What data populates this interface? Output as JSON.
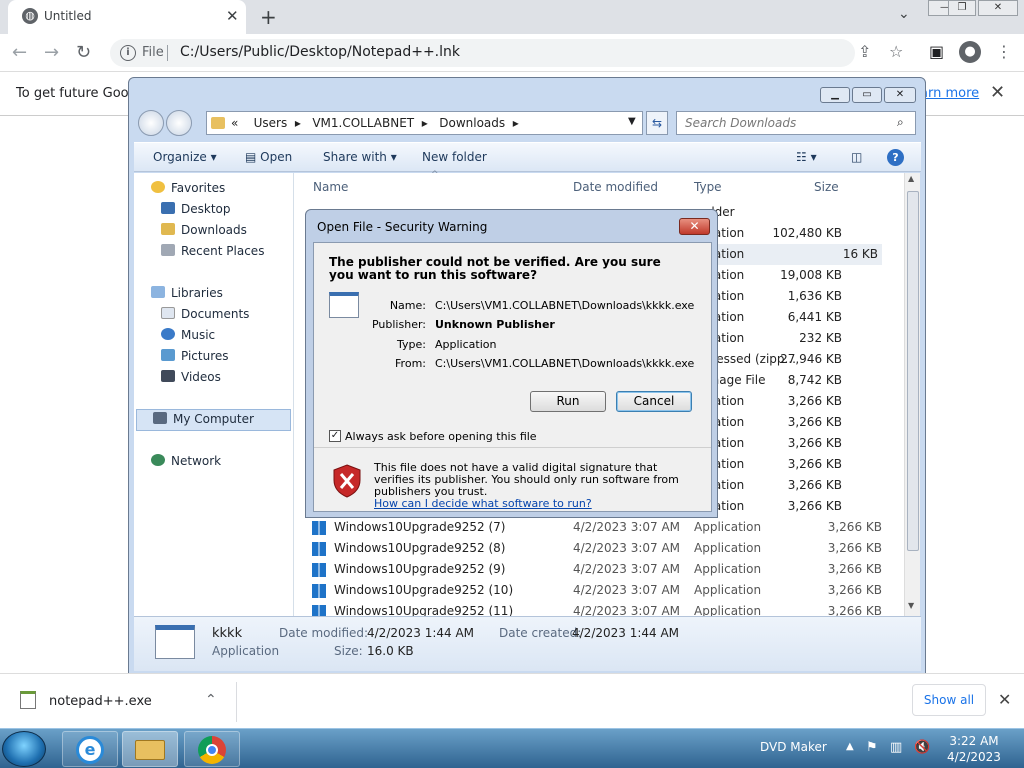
{
  "browser": {
    "tab_title": "Untitled",
    "url_scheme": "File",
    "url": "C:/Users/Public/Desktop/Notepad++.lnk",
    "infobar_text": "To get future Googl",
    "infobar_link": "arn more"
  },
  "explorer": {
    "breadcrumb": [
      "«",
      "Users",
      "VM1.COLLABNET",
      "Downloads"
    ],
    "search_placeholder": "Search Downloads",
    "commands": {
      "organize": "Organize",
      "open": "Open",
      "share": "Share with",
      "new_folder": "New folder"
    },
    "nav": {
      "favorites": "Favorites",
      "desktop": "Desktop",
      "downloads": "Downloads",
      "recent": "Recent Places",
      "libraries": "Libraries",
      "documents": "Documents",
      "music": "Music",
      "pictures": "Pictures",
      "videos": "Videos",
      "computer": "My Computer",
      "network": "Network"
    },
    "columns": {
      "name": "Name",
      "date": "Date modified",
      "type": "Type",
      "size": "Size"
    },
    "right_rows": [
      {
        "type": "older",
        "size": ""
      },
      {
        "type": "ication",
        "size": "102,480 KB"
      },
      {
        "type": "ication",
        "size": "16 KB"
      },
      {
        "type": "ication",
        "size": "19,008 KB"
      },
      {
        "type": "ication",
        "size": "1,636 KB"
      },
      {
        "type": "ication",
        "size": "6,441 KB"
      },
      {
        "type": "ication",
        "size": "232 KB"
      },
      {
        "type": "pressed (zipp...",
        "size": "27,946 KB"
      },
      {
        "type": "Image File",
        "size": "8,742 KB"
      },
      {
        "type": "ication",
        "size": "3,266 KB"
      },
      {
        "type": "ication",
        "size": "3,266 KB"
      },
      {
        "type": "ication",
        "size": "3,266 KB"
      },
      {
        "type": "ication",
        "size": "3,266 KB"
      },
      {
        "type": "ication",
        "size": "3,266 KB"
      },
      {
        "type": "ication",
        "size": "3,266 KB"
      }
    ],
    "rows": [
      {
        "name": "Windows10Upgrade9252 (7)",
        "date": "4/2/2023 3:07 AM",
        "type": "Application",
        "size": "3,266 KB"
      },
      {
        "name": "Windows10Upgrade9252 (8)",
        "date": "4/2/2023 3:07 AM",
        "type": "Application",
        "size": "3,266 KB"
      },
      {
        "name": "Windows10Upgrade9252 (9)",
        "date": "4/2/2023 3:07 AM",
        "type": "Application",
        "size": "3,266 KB"
      },
      {
        "name": "Windows10Upgrade9252 (10)",
        "date": "4/2/2023 3:07 AM",
        "type": "Application",
        "size": "3,266 KB"
      },
      {
        "name": "Windows10Upgrade9252 (11)",
        "date": "4/2/2023 3:07 AM",
        "type": "Application",
        "size": "3,266 KB"
      }
    ],
    "details": {
      "name": "kkkk",
      "kind": "Application",
      "modified_label": "Date modified:",
      "modified": "4/2/2023 1:44 AM",
      "created_label": "Date created:",
      "created": "4/2/2023 1:44 AM",
      "size_label": "Size:",
      "size": "16.0 KB"
    }
  },
  "dialog": {
    "title": "Open File - Security Warning",
    "question": "The publisher could not be verified.  Are you sure you want to run this software?",
    "name_label": "Name:",
    "name": "C:\\Users\\VM1.COLLABNET\\Downloads\\kkkk.exe",
    "publisher_label": "Publisher:",
    "publisher": "Unknown Publisher",
    "type_label": "Type:",
    "type": "Application",
    "from_label": "From:",
    "from": "C:\\Users\\VM1.COLLABNET\\Downloads\\kkkk.exe",
    "run": "Run",
    "cancel": "Cancel",
    "checkbox": "Always ask before opening this file",
    "footer": "This file does not have a valid digital signature that verifies its publisher.  You should only run software from publishers you trust.",
    "footer_link": "How can I decide what software to run?"
  },
  "downloads": {
    "file": "notepad++.exe",
    "show_all": "Show all"
  },
  "taskbar": {
    "dvd_maker": "DVD Maker",
    "time": "3:22 AM",
    "date": "4/2/2023"
  }
}
